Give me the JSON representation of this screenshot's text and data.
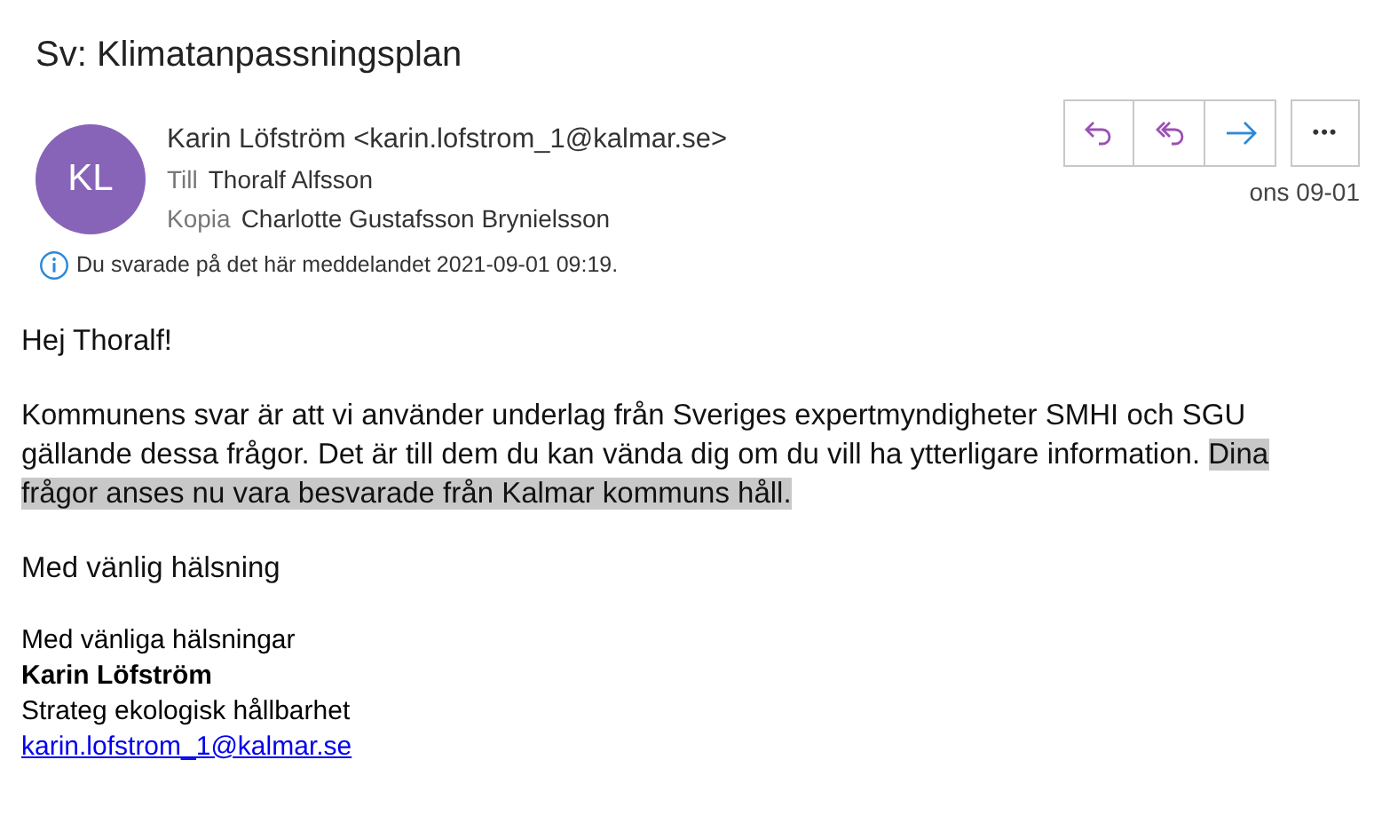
{
  "subject": "Sv: Klimatanpassningsplan",
  "sender": {
    "initials": "KL",
    "name": "Karin Löfström <karin.lofstrom_1@kalmar.se>"
  },
  "recipients": [
    {
      "label": "Till",
      "value": "Thoralf Alfsson"
    },
    {
      "label": "Kopia",
      "value": "Charlotte Gustafsson Brynielsson"
    }
  ],
  "actions": [
    {
      "kind": "reply"
    },
    {
      "kind": "reply-all"
    },
    {
      "kind": "forward"
    }
  ],
  "more_button": "•••",
  "date": "ons 09-01",
  "info": "Du svarade på det här meddelandet 2021-09-01 09:19.",
  "body": [
    {
      "kind": "text",
      "segments": [
        {
          "text": "Hej Thoralf!",
          "highlighted": false
        }
      ]
    },
    {
      "kind": "text",
      "segments": [
        {
          "text": "Kommunens svar är att vi använder underlag från Sveriges expertmyndigheter SMHI och SGU gällande dessa frågor. Det är till dem du kan vända dig om du vill ha ytterligare information. ",
          "highlighted": false
        },
        {
          "text": "Dina frågor anses nu vara besvarade från Kalmar kommuns håll. ",
          "highlighted": true
        }
      ]
    },
    {
      "kind": "text",
      "segments": [
        {
          "text": "Med vänlig hälsning",
          "highlighted": false
        }
      ]
    }
  ],
  "signature": [
    {
      "kind": "plain",
      "text": "Med vänliga hälsningar"
    },
    {
      "kind": "bold",
      "text": "Karin Löfström"
    },
    {
      "kind": "plain",
      "text": "Strateg ekologisk hållbarhet"
    },
    {
      "kind": "link",
      "text": "karin.lofstrom_1@kalmar.se"
    }
  ]
}
